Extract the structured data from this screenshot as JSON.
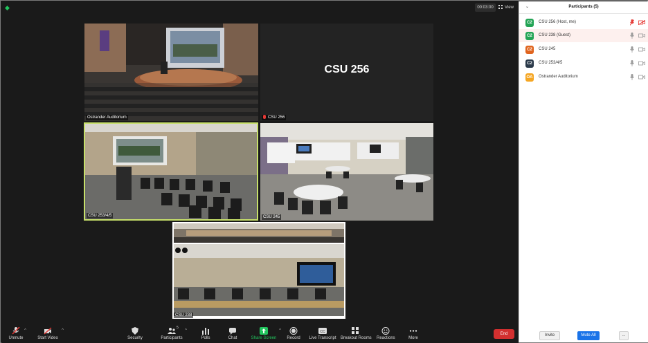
{
  "meeting": {
    "timer": "00:03:00",
    "view_label": "View"
  },
  "tiles": [
    {
      "name": "Ostrander Auditorium"
    },
    {
      "name": "CSU 256",
      "big_name": "CSU 256"
    },
    {
      "name": "CSU 253/4/5"
    },
    {
      "name": "CSU 245"
    },
    {
      "name": "CSU 238"
    }
  ],
  "toolbar": {
    "unmute": "Unmute",
    "start_video": "Start Video",
    "security": "Security",
    "participants": "Participants",
    "participants_count": "5",
    "polls": "Polls",
    "chat": "Chat",
    "share_screen": "Share Screen",
    "record": "Record",
    "live_transcript": "Live Transcript",
    "breakout_rooms": "Breakout Rooms",
    "reactions": "Reactions",
    "more": "More",
    "end": "End"
  },
  "panel": {
    "title": "Participants (5)",
    "participants": [
      {
        "initials": "C2",
        "name": "CSU 256 (Host, me)",
        "avatar_color": "#23a455",
        "muted": true
      },
      {
        "initials": "C2",
        "name": "CSU 238 (Guest)",
        "avatar_color": "#23a455",
        "muted": false
      },
      {
        "initials": "C2",
        "name": "CSU 245",
        "avatar_color": "#e0641e",
        "muted": false
      },
      {
        "initials": "C2",
        "name": "CSU 253/4/5",
        "avatar_color": "#2b3a4a",
        "muted": false
      },
      {
        "initials": "OA",
        "name": "Ostrander Auditorium",
        "avatar_color": "#f5a623",
        "muted": false
      }
    ],
    "invite": "Invite",
    "mute_all": "Mute All",
    "more": "..."
  }
}
